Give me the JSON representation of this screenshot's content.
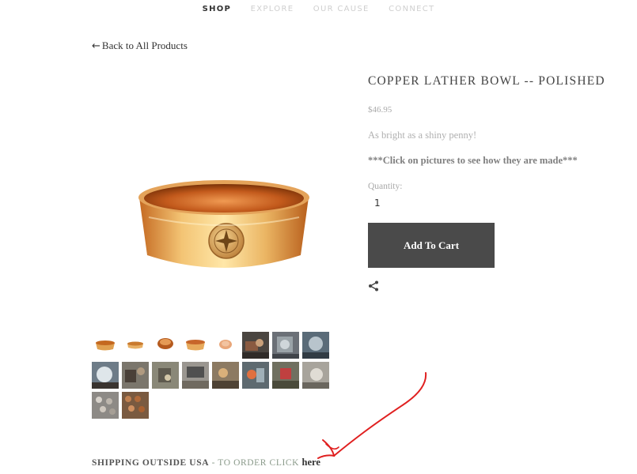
{
  "nav": {
    "items": [
      {
        "label": "SHOP",
        "active": true
      },
      {
        "label": "EXPLORE",
        "active": false
      },
      {
        "label": "OUR CAUSE",
        "active": false
      },
      {
        "label": "CONNECT",
        "active": false
      }
    ]
  },
  "back_link": {
    "arrow": "←",
    "label": "Back to All Products"
  },
  "product": {
    "title": "COPPER LATHER BOWL -- POLISHED",
    "price": "$46.95",
    "description_1": "As bright as a shiny penny!",
    "description_2": "***Click on pictures to see how they are made***",
    "quantity_label": "Quantity:",
    "quantity_value": "1",
    "add_to_cart_label": "Add To Cart"
  },
  "shipping": {
    "bold_text": "SHIPPING OUTSIDE USA",
    "separator": " - ",
    "light_text": "TO ORDER CLICK ",
    "link_text": "here"
  },
  "colors": {
    "button_bg": "#4a4a4a",
    "copper": "#d98a3d",
    "annotation_red": "#e02020"
  },
  "icons": {
    "share": "share-icon"
  }
}
